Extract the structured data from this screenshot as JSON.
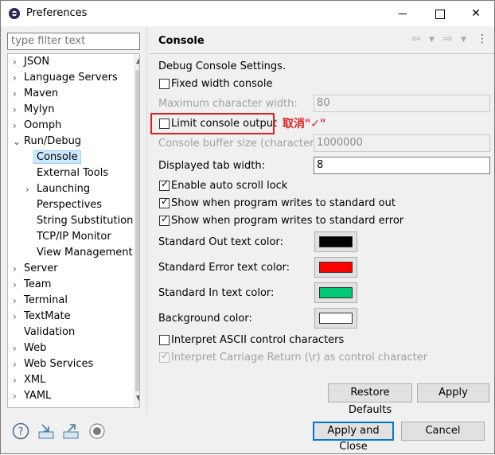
{
  "window": {
    "title": "Preferences"
  },
  "filter": {
    "placeholder": "type filter text"
  },
  "tree": {
    "items": [
      {
        "label": "JSON",
        "expander": "collapsed"
      },
      {
        "label": "Language Servers",
        "expander": "collapsed"
      },
      {
        "label": "Maven",
        "expander": "collapsed"
      },
      {
        "label": "Mylyn",
        "expander": "collapsed"
      },
      {
        "label": "Oomph",
        "expander": "collapsed"
      },
      {
        "label": "Run/Debug",
        "expander": "expanded"
      },
      {
        "label": "Console",
        "selected": true
      },
      {
        "label": "External Tools"
      },
      {
        "label": "Launching",
        "expander": "collapsed"
      },
      {
        "label": "Perspectives"
      },
      {
        "label": "String Substitution"
      },
      {
        "label": "TCP/IP Monitor"
      },
      {
        "label": "View Management"
      },
      {
        "label": "Server",
        "expander": "collapsed"
      },
      {
        "label": "Team",
        "expander": "collapsed"
      },
      {
        "label": "Terminal",
        "expander": "collapsed"
      },
      {
        "label": "TextMate",
        "expander": "collapsed"
      },
      {
        "label": "Validation"
      },
      {
        "label": "Web",
        "expander": "collapsed"
      },
      {
        "label": "Web Services",
        "expander": "collapsed"
      },
      {
        "label": "XML",
        "expander": "collapsed"
      },
      {
        "label": "YAML",
        "expander": "collapsed"
      }
    ]
  },
  "panel": {
    "title": "Console",
    "intro": "Debug Console Settings.",
    "fixed_width": {
      "label": "Fixed width console",
      "checked": false
    },
    "max_char_width": {
      "label": "Maximum character width:",
      "value": "80",
      "disabled": true
    },
    "limit_output": {
      "label": "Limit console output",
      "checked": false
    },
    "buffer_size": {
      "label": "Console buffer size (characters):",
      "value": "1000000",
      "disabled": true
    },
    "tab_width": {
      "label": "Displayed tab width:",
      "value": "8"
    },
    "auto_scroll": {
      "label": "Enable auto scroll lock",
      "checked": true
    },
    "show_out": {
      "label": "Show when program writes to standard out",
      "checked": true
    },
    "show_err": {
      "label": "Show when program writes to standard error",
      "checked": true
    },
    "colors": [
      {
        "label": "Standard Out text color:",
        "color": "#000000"
      },
      {
        "label": "Standard Error text color:",
        "color": "#ff0000"
      },
      {
        "label": "Standard In text color:",
        "color": "#00c878"
      },
      {
        "label": "Background color:",
        "color": "#ffffff"
      }
    ],
    "ascii": {
      "label": "Interpret ASCII control characters",
      "checked": false
    },
    "carriage": {
      "label": "Interpret Carriage Return (\\r) as control character",
      "checked": true,
      "disabled": true
    },
    "restore_defaults": "Restore Defaults",
    "apply": "Apply"
  },
  "annotation": {
    "text": "取消\"✓\"",
    "color": "#e02020"
  },
  "footer": {
    "apply_close": "Apply and Close",
    "cancel": "Cancel"
  },
  "icons": [
    "help-icon",
    "import-icon",
    "export-icon",
    "record-icon"
  ]
}
